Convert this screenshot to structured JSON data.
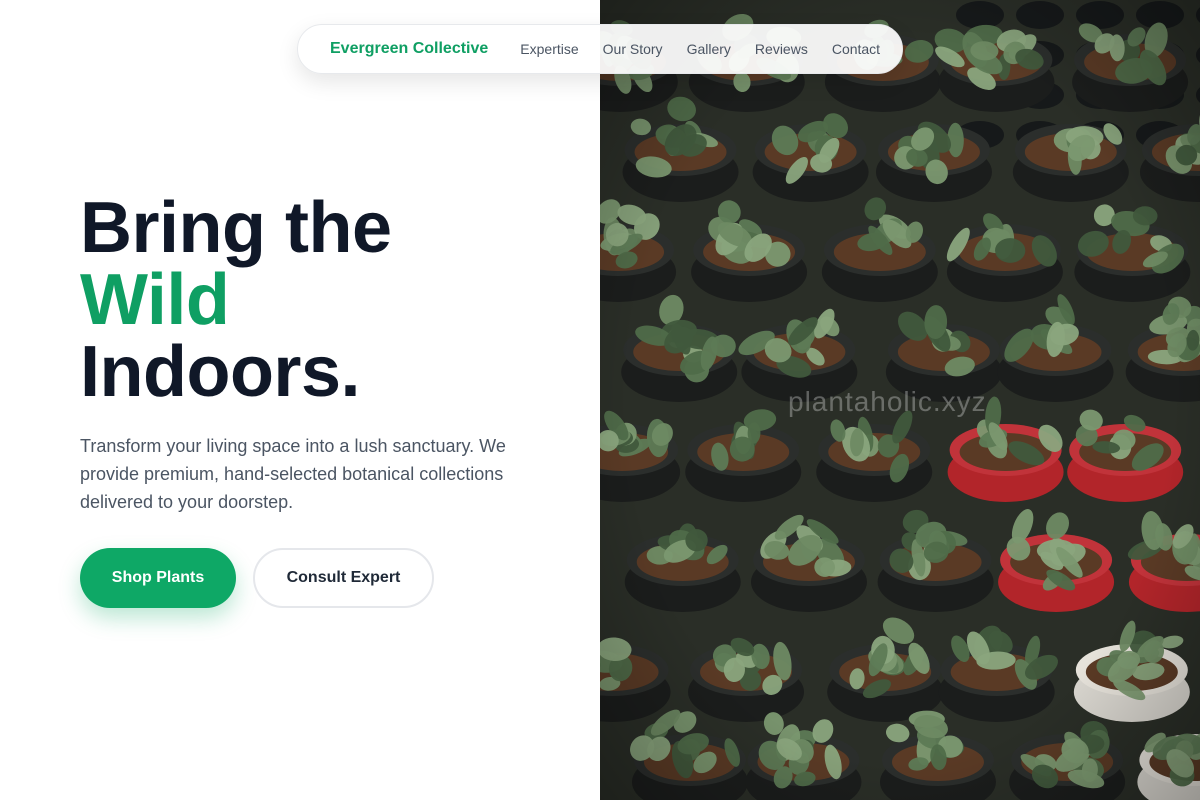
{
  "nav": {
    "brand": "Evergreen Collective",
    "links": [
      "Expertise",
      "Our Story",
      "Gallery",
      "Reviews",
      "Contact"
    ]
  },
  "hero": {
    "headline_line1": "Bring the",
    "headline_accent": "Wild",
    "headline_line3": "Indoors.",
    "description": "Transform your living space into a lush sanctuary. We provide premium, hand-selected botanical collections delivered to your doorstep.",
    "primary_button": "Shop Plants",
    "secondary_button": "Consult Expert"
  },
  "image": {
    "watermark": "plantaholic.xyz",
    "subject": "potted seedlings in a greenhouse tray"
  },
  "colors": {
    "accent": "#0f9f63",
    "heading": "#101828",
    "body_text": "#4b5563",
    "button_primary": "#0ea866"
  }
}
